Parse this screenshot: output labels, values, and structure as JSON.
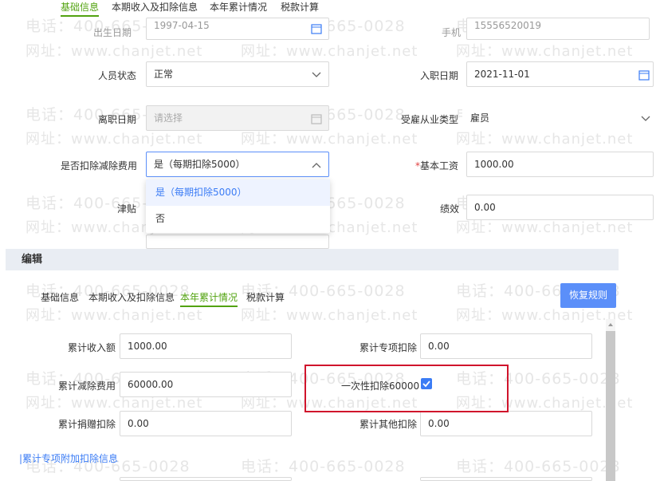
{
  "top_tabs": [
    "基础信息",
    "本期收入及扣除信息",
    "本年累计情况",
    "税款计算"
  ],
  "watermark": {
    "phone": "电话：400-665-0028",
    "site": "网址：www.chanjet.net"
  },
  "basic": {
    "birth_label": "出生日期",
    "birth_value": "1997-04-15",
    "phone_label": "手机",
    "phone_value": "15556520019",
    "status_label": "人员状态",
    "status_value": "正常",
    "hire_label": "入职日期",
    "hire_value": "2021-11-01",
    "leave_label": "离职日期",
    "leave_placeholder": "请选择",
    "employ_label": "受雇从业类型",
    "employ_value": "雇员",
    "deduct_label": "是否扣除减除费用",
    "deduct_value": "是（每期扣除5000）",
    "base_label": "基本工资",
    "base_required": "*",
    "base_value": "1000.00",
    "allowance_label": "津贴",
    "perf_label": "绩效",
    "perf_value": "0.00"
  },
  "dropdown": {
    "options": [
      "是（每期扣除5000）",
      "否"
    ],
    "selected": 0
  },
  "edit": {
    "title": "编辑",
    "tabs": [
      "基础信息",
      "本期收入及扣除信息",
      "本年累计情况",
      "税款计算"
    ],
    "active_tab": 2,
    "reset_button": "恢复规则",
    "income_label": "累计收入额",
    "income_value": "1000.00",
    "special_label": "累计专项扣除",
    "special_value": "0.00",
    "reduce_label": "累计减除费用",
    "reduce_value": "60000.00",
    "onetime_label": "一次性扣除60000",
    "onetime_checked": true,
    "donation_label": "累计捐赠扣除",
    "donation_value": "0.00",
    "other_label": "累计其他扣除",
    "other_value": "0.00",
    "section_label": "|累计专项附加扣除信息"
  },
  "colors": {
    "active_tab": "#52a310",
    "primary": "#5b8ff9",
    "highlight": "#d0142c"
  }
}
